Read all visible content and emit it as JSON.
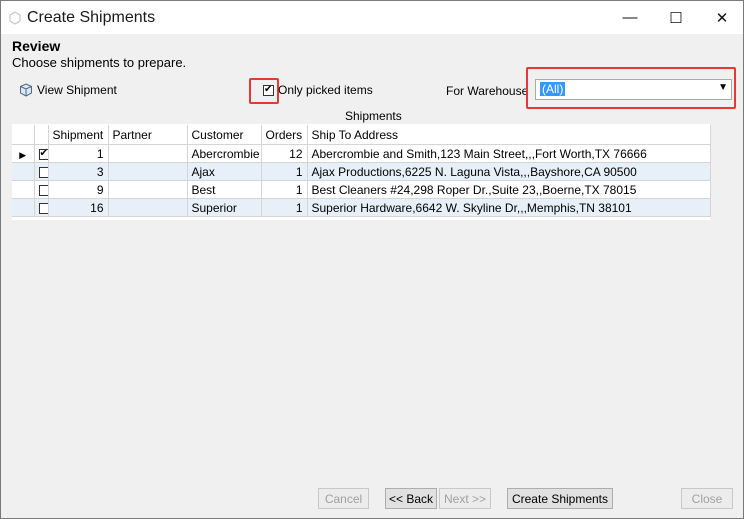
{
  "window": {
    "title": "Create Shipments",
    "minimize": "—",
    "maximize": "☐",
    "close": "✕"
  },
  "header": {
    "title": "Review",
    "subtitle": "Choose shipments to prepare."
  },
  "toolbar": {
    "view_shipment": "View Shipment",
    "only_picked_label": "Only picked items",
    "only_picked_checked": true,
    "warehouse_label": "For Warehouse",
    "warehouse_value": "(All)"
  },
  "grid": {
    "caption": "Shipments",
    "columns": [
      "Shipment",
      "Partner",
      "Customer",
      "Orders",
      "Ship To Address"
    ],
    "rows": [
      {
        "current": true,
        "checked": true,
        "shipment": "1",
        "partner": "",
        "customer": "Abercrombie",
        "orders": "12",
        "address": "Abercrombie and Smith,123 Main Street,,,Fort Worth,TX 76666"
      },
      {
        "current": false,
        "checked": false,
        "shipment": "3",
        "partner": "",
        "customer": "Ajax",
        "orders": "1",
        "address": "Ajax Productions,6225 N. Laguna Vista,,,Bayshore,CA 90500"
      },
      {
        "current": false,
        "checked": false,
        "shipment": "9",
        "partner": "",
        "customer": "Best",
        "orders": "1",
        "address": "Best Cleaners #24,298 Roper Dr.,Suite 23,,Boerne,TX 78015"
      },
      {
        "current": false,
        "checked": false,
        "shipment": "16",
        "partner": "",
        "customer": "Superior",
        "orders": "1",
        "address": "Superior Hardware,6642 W. Skyline Dr,,,Memphis,TN 38101"
      }
    ]
  },
  "footer": {
    "cancel": "Cancel",
    "back": "<< Back",
    "next": "Next >>",
    "create": "Create Shipments",
    "close": "Close"
  },
  "colors": {
    "highlight_red": "#e53935",
    "selection_blue": "#3399ff",
    "alt_row": "#e7f0f9"
  }
}
